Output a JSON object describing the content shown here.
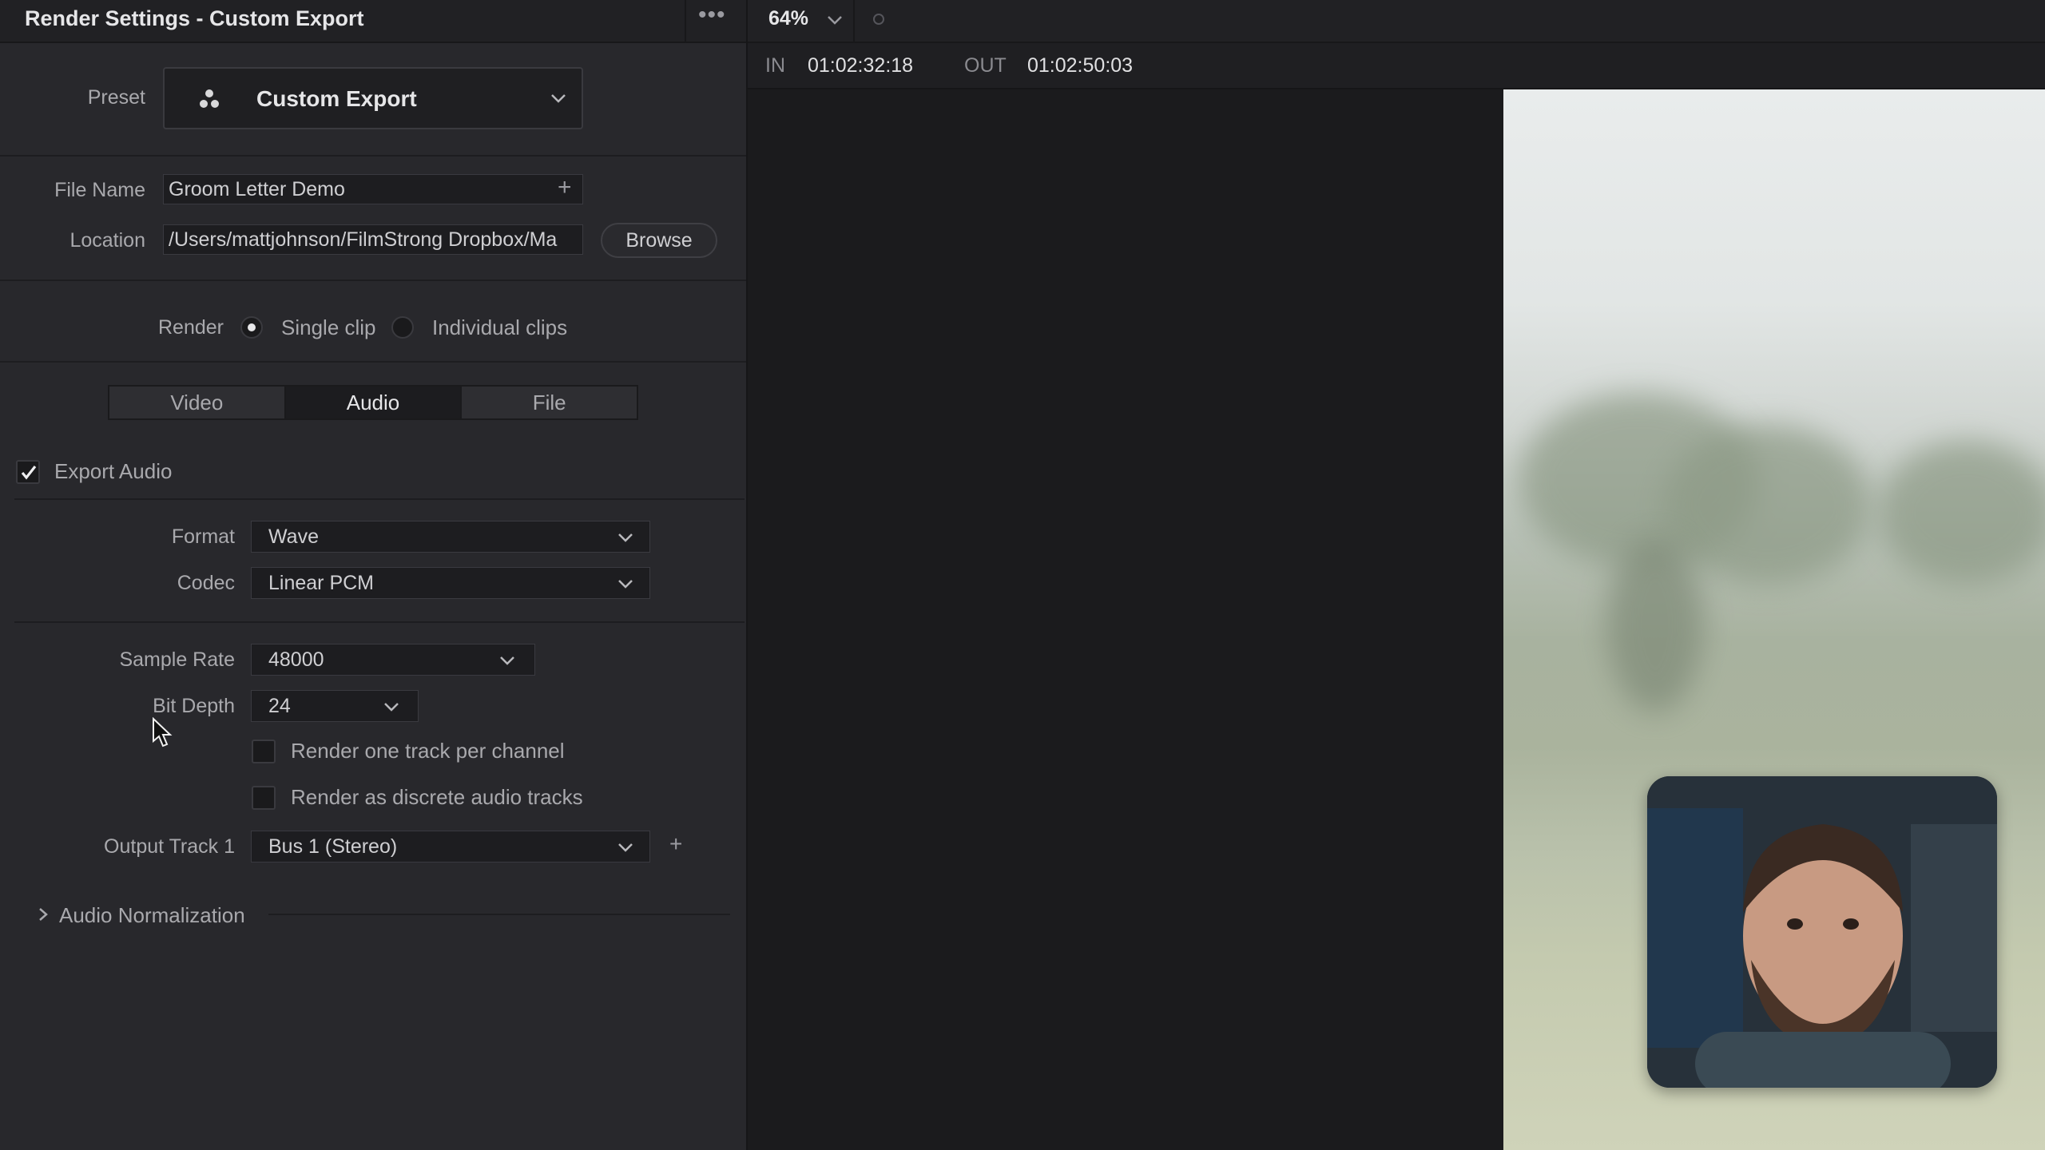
{
  "window": {
    "title": "Render Settings - Custom Export"
  },
  "preset": {
    "label": "Preset",
    "value": "Custom Export"
  },
  "file": {
    "name_label": "File Name",
    "name_value": "Groom Letter Demo",
    "location_label": "Location",
    "location_value": "/Users/mattjohnson/FilmStrong Dropbox/Ma",
    "browse_label": "Browse"
  },
  "render": {
    "label": "Render",
    "options": [
      "Single clip",
      "Individual clips"
    ],
    "selected": "Single clip"
  },
  "tabs": [
    {
      "label": "Video",
      "active": false
    },
    {
      "label": "Audio",
      "active": true
    },
    {
      "label": "File",
      "active": false
    }
  ],
  "audio": {
    "export_label": "Export Audio",
    "export_checked": true,
    "format_label": "Format",
    "format_value": "Wave",
    "codec_label": "Codec",
    "codec_value": "Linear PCM",
    "sample_rate_label": "Sample Rate",
    "sample_rate_value": "48000",
    "bit_depth_label": "Bit Depth",
    "bit_depth_value": "24",
    "one_track_label": "Render one track per channel",
    "one_track_checked": false,
    "discrete_label": "Render as discrete audio tracks",
    "discrete_checked": false,
    "output_track_label": "Output Track 1",
    "output_track_value": "Bus 1 (Stereo)",
    "normalization_label": "Audio Normalization"
  },
  "viewer": {
    "zoom": "64%",
    "in_label": "IN",
    "in_value": "01:02:32:18",
    "out_label": "OUT",
    "out_value": "01:02:50:03"
  },
  "icons": [
    "more-icon",
    "preset-icon",
    "chevron-down-icon",
    "plus-icon",
    "checkmark-icon",
    "chevron-right-icon",
    "cursor-icon"
  ]
}
